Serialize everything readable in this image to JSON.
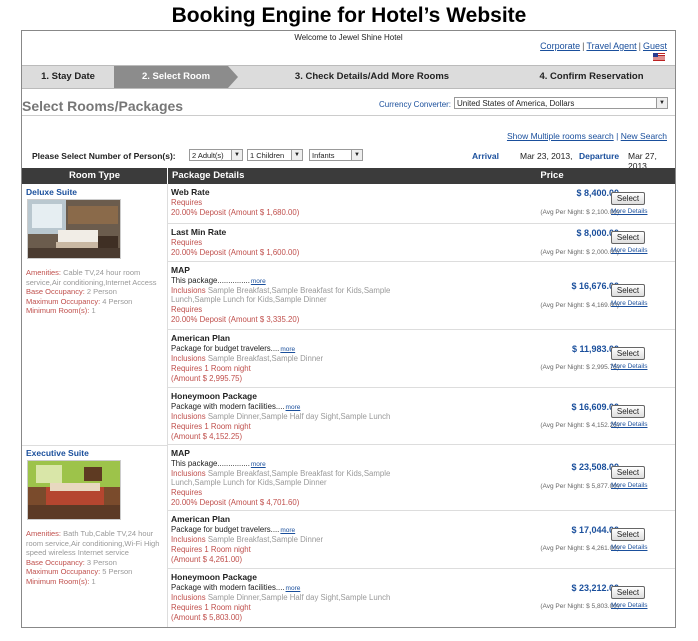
{
  "caption": "Booking Engine for Hotel’s Website",
  "welcome": "Welcome to Jewel Shine Hotel",
  "top_links": [
    "Corporate",
    "Travel Agent",
    "Guest"
  ],
  "steps": [
    {
      "label": "1. Stay Date",
      "active": false
    },
    {
      "label": "2. Select Room",
      "active": true
    },
    {
      "label": "3. Check Details/Add More Rooms",
      "active": false
    },
    {
      "label": "4. Confirm Reservation",
      "active": false
    }
  ],
  "page_title": "Select Rooms/Packages",
  "currency": {
    "label": "Currency Converter:",
    "value": "United States of America, Dollars"
  },
  "search_links": {
    "multi": "Show Multiple rooms search",
    "sep": "|",
    "new": "New Search"
  },
  "persons": {
    "label": "Please Select Number of Person(s):",
    "adults": "2 Adult(s)",
    "children": "1 Children",
    "infants": "Infants",
    "arrival_label": "Arrival",
    "arrival": "Mar 23, 2013,",
    "departure_label": "Departure",
    "departure": "Mar 27, 2013"
  },
  "table_headers": {
    "room_type": "Room Type",
    "package": "Package Details",
    "price": "Price"
  },
  "rooms": [
    {
      "name": "Deluxe Suite",
      "amenities_label": "Amenities:",
      "amenities_l1": "Cable TV,24 hour room",
      "amenities_l2": "service,Air conditioning,Internet Access",
      "base_label": "Base Occupancy:",
      "base": "2 Person",
      "max_label": "Maximum Occupancy:",
      "max": "4 Person",
      "min_label": "Minimum Room(s):",
      "min": "1"
    },
    {
      "name": "Executive Suite",
      "amenities_label": "Amenities:",
      "amenities_l1": "Bath Tub,Cable TV,24 hour",
      "amenities_l2": "room service,Air conditioning,Wi-Fi High",
      "amenities_l3": "speed wireless Internet service",
      "base_label": "Base Occupancy:",
      "base": "3 Person",
      "max_label": "Maximum Occupancy:",
      "max": "5 Person",
      "min_label": "Minimum Room(s):",
      "min": "1"
    }
  ],
  "packages": [
    {
      "name": "Web Rate",
      "requires": "Requires",
      "deposit": "20.00% Deposit (Amount $ 1,680.00)",
      "price": "$ 8,400.00",
      "avg": "(Avg Per Night: $ 2,100.00)"
    },
    {
      "name": "Last Min Rate",
      "requires": "Requires",
      "deposit": "20.00% Deposit (Amount $ 1,600.00)",
      "price": "$ 8,000.00",
      "avg": "(Avg Per Night: $ 2,000.00)"
    },
    {
      "name": "MAP",
      "desc": "This package...............",
      "more": "more",
      "incl_label": "Inclusions",
      "incl1": "Sample Breakfast,Sample Breakfast for Kids,Sample",
      "incl2": "Lunch,Sample Lunch for Kids,Sample Dinner",
      "requires": "Requires",
      "deposit": "20.00% Deposit (Amount $ 3,335.20)",
      "price": "$ 16,676.00",
      "avg": "(Avg Per Night: $ 4,169.00)"
    },
    {
      "name": "American Plan",
      "desc": "Package for budget travelers....",
      "more": "more",
      "incl_label": "Inclusions",
      "incl1": "Sample Breakfast,Sample Dinner",
      "requires": "Requires 1 Room night",
      "amount": "(Amount $ 2,995.75)",
      "price": "$ 11,983.00",
      "avg": "(Avg Per Night: $ 2,995.75)"
    },
    {
      "name": "Honeymoon Package",
      "desc": "Package with modern facilities....",
      "more": "more",
      "incl_label": "Inclusions",
      "incl1": "Sample Dinner,Sample Half day Sight,Sample Lunch",
      "requires": "Requires 1 Room night",
      "amount": "(Amount $ 4,152.25)",
      "price": "$ 16,609.00",
      "avg": "(Avg Per Night: $ 4,152.25)"
    },
    {
      "name": "MAP",
      "desc": "This package...............",
      "more": "more",
      "incl_label": "Inclusions",
      "incl1": "Sample Breakfast,Sample Breakfast for Kids,Sample",
      "incl2": "Lunch,Sample Lunch for Kids,Sample Dinner",
      "requires": "Requires",
      "deposit": "20.00% Deposit (Amount $ 4,701.60)",
      "price": "$ 23,508.00",
      "avg": "(Avg Per Night: $ 5,877.00)"
    },
    {
      "name": "American Plan",
      "desc": "Package for budget travelers....",
      "more": "more",
      "incl_label": "Inclusions",
      "incl1": "Sample Breakfast,Sample Dinner",
      "requires": "Requires 1 Room night",
      "amount": "(Amount $ 4,261.00)",
      "price": "$ 17,044.00",
      "avg": "(Avg Per Night: $ 4,261.00)"
    },
    {
      "name": "Honeymoon Package",
      "desc": "Package with modern facilities....",
      "more": "more",
      "incl_label": "Inclusions",
      "incl1": "Sample Dinner,Sample Half day Sight,Sample Lunch",
      "requires": "Requires 1 Room night",
      "amount": "(Amount $ 5,803.00)",
      "price": "$ 23,212.00",
      "avg": "(Avg Per Night: $ 5,803.00)"
    }
  ],
  "select_label": "Select",
  "more_details_label": "More Details"
}
